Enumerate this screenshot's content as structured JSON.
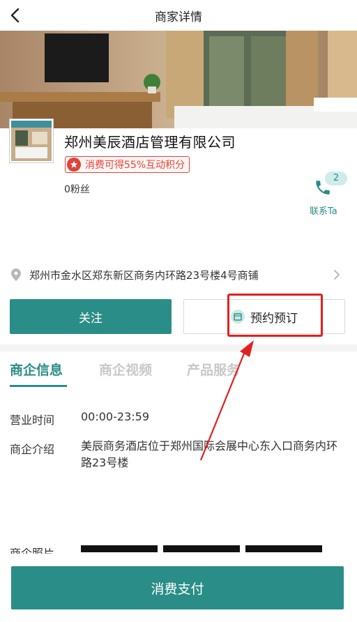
{
  "header": {
    "title": "商家详情"
  },
  "company": {
    "name": "郑州美辰酒店管理有限公司",
    "points_badge": "消费可得55%互动积分",
    "fans": "0粉丝"
  },
  "contact": {
    "badge_count": "2",
    "label": "联系Ta"
  },
  "address": {
    "text": "郑州市金水区郑东新区商务内环路23号楼4号商铺"
  },
  "buttons": {
    "follow": "关注",
    "reserve": "预约预订",
    "pay": "消费支付"
  },
  "tabs": [
    {
      "label": "商企信息"
    },
    {
      "label": "商企视频"
    },
    {
      "label": "产品服务"
    }
  ],
  "info": {
    "hours_label": "营业时间",
    "hours_value": "00:00-23:59",
    "intro_label": "商企介绍",
    "intro_value": "美辰商务酒店位于郑州国际会展中心东入口商务内环路23号楼"
  },
  "photos": {
    "label": "商企照片"
  },
  "colors": {
    "accent": "#2a8d87",
    "badge_red": "#e0443a",
    "annotation_red": "#e0211f"
  }
}
